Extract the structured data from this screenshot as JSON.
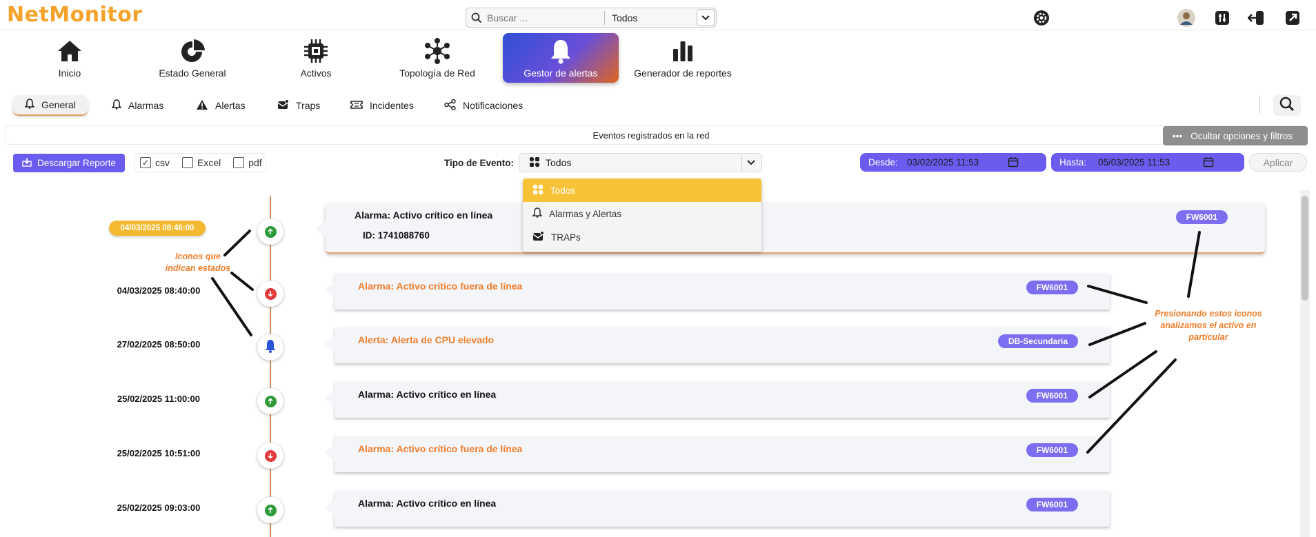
{
  "app": {
    "logo": "NetMonitor"
  },
  "topbar": {
    "search_placeholder": "Buscar ...",
    "search_scope": "Todos",
    "icons": [
      "settings-icon",
      "avatar",
      "sliders-icon",
      "logout-icon",
      "external-link-icon"
    ]
  },
  "main_nav": [
    {
      "label": "Inicio",
      "icon": "home-icon",
      "active": false
    },
    {
      "label": "Estado General",
      "icon": "pie-chart-icon",
      "active": false
    },
    {
      "label": "Activos",
      "icon": "chip-icon",
      "active": false
    },
    {
      "label": "Topología de Red",
      "icon": "network-icon",
      "active": false
    },
    {
      "label": "Gestor de alertas",
      "icon": "bell-icon",
      "active": true
    },
    {
      "label": "Generador de reportes",
      "icon": "bar-chart-icon",
      "active": false
    }
  ],
  "sub_nav": [
    {
      "label": "General",
      "icon": "bell-icon",
      "active": true
    },
    {
      "label": "Alarmas",
      "icon": "bell-icon",
      "active": false
    },
    {
      "label": "Alertas",
      "icon": "warning-icon",
      "active": false
    },
    {
      "label": "Traps",
      "icon": "mail-icon",
      "active": false
    },
    {
      "label": "Incidentes",
      "icon": "ticket-icon",
      "active": false
    },
    {
      "label": "Notificaciones",
      "icon": "share-icon",
      "active": false
    }
  ],
  "banner": {
    "title": "Eventos registrados en la red",
    "hide_button": "Ocultar opciones y filtros"
  },
  "filters": {
    "download_button": "Descargar Reporte",
    "formats": [
      {
        "label": "csv",
        "checked": true
      },
      {
        "label": "Excel",
        "checked": false
      },
      {
        "label": "pdf",
        "checked": false
      }
    ],
    "event_type_label": "Tipo de Evento:",
    "event_type_value": "Todos",
    "from_label": "Desde:",
    "from_value": "03/02/2025 11:53",
    "to_label": "Hasta:",
    "to_value": "05/03/2025 11:53",
    "apply_button": "Aplicar"
  },
  "dropdown": {
    "options": [
      {
        "label": "Todos",
        "selected": true
      },
      {
        "label": "Alarmas y Alertas",
        "selected": false
      },
      {
        "label": "TRAPs",
        "selected": false
      }
    ]
  },
  "events": [
    {
      "timestamp": "04/03/2025 08:46:00",
      "status": "up",
      "title": "Alarma: Activo crítico en línea",
      "id_text": "ID: 1741088760",
      "tag": "FW6001",
      "highlight": false
    },
    {
      "timestamp": "04/03/2025 08:40:00",
      "status": "down",
      "title": "Alarma: Activo crítico fuera de línea",
      "tag": "FW6001",
      "highlight": true
    },
    {
      "timestamp": "27/02/2025 08:50:00",
      "status": "bell",
      "title": "Alerta: Alerta de CPU elevado",
      "tag": "DB-Secundaria",
      "highlight": true
    },
    {
      "timestamp": "25/02/2025 11:00:00",
      "status": "up",
      "title": "Alarma: Activo crítico en línea",
      "tag": "FW6001",
      "highlight": false
    },
    {
      "timestamp": "25/02/2025 10:51:00",
      "status": "down",
      "title": "Alarma: Activo crítico fuera de línea",
      "tag": "FW6001",
      "highlight": true
    },
    {
      "timestamp": "25/02/2025 09:03:00",
      "status": "up",
      "title": "Alarma: Activo crítico en línea",
      "tag": "FW6001",
      "highlight": false
    }
  ],
  "annotations": {
    "left_note_line1": "Iconos que",
    "left_note_line2": "indican estados",
    "right_note_line1": "Presionando estos iconos",
    "right_note_line2": "analizamos el activo en",
    "right_note_line3": "particular"
  },
  "colors": {
    "accent_orange": "#f4a22a",
    "accent_purple": "#6b5cf0",
    "status_up": "#2e9b3a",
    "status_down": "#e13b3b",
    "highlight_text": "#f07d2a"
  }
}
